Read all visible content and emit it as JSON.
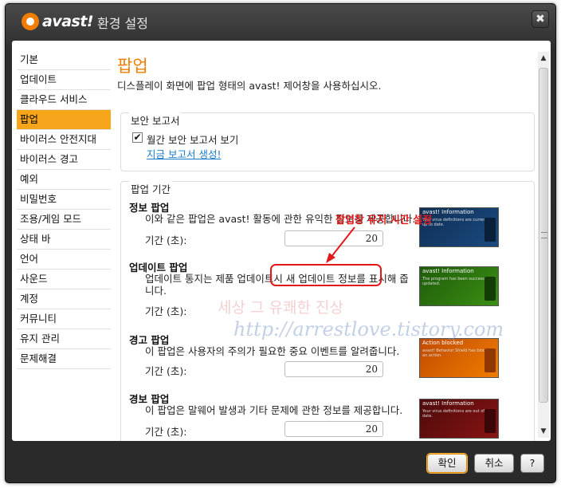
{
  "window": {
    "logo_text": "avast!",
    "title": "환경 설정",
    "close_glyph": "✖"
  },
  "sidebar": {
    "items": [
      {
        "label": "기본"
      },
      {
        "label": "업데이트"
      },
      {
        "label": "클라우드 서비스"
      },
      {
        "label": "팝업",
        "active": true
      },
      {
        "label": "바이러스 안전지대"
      },
      {
        "label": "바이러스 경고"
      },
      {
        "label": "예외"
      },
      {
        "label": "비밀번호"
      },
      {
        "label": "조용/게임 모드"
      },
      {
        "label": "상태 바"
      },
      {
        "label": "언어"
      },
      {
        "label": "사운드"
      },
      {
        "label": "계정"
      },
      {
        "label": "커뮤니티"
      },
      {
        "label": "유지 관리"
      },
      {
        "label": "문제해결"
      }
    ]
  },
  "main": {
    "title": "팝업",
    "description": "디스플레이 화면에 팝업 형태의 avast! 제어창을 사용하십시오.",
    "security_report": {
      "group_title": "보안 보고서",
      "checkbox_label": "월간 보안 보고서 보기",
      "checked": true,
      "link": "지금 보고서 생성!"
    },
    "popup_duration": {
      "group_title": "팝업 기간",
      "duration_label": "기간 (초):",
      "sections": [
        {
          "title": "정보 팝업",
          "description": "이와 같은 팝업은 avast! 활동에 관한 유익한 정보를 제공합니다.",
          "value": "20",
          "thumb_title": "avast! Information",
          "thumb_text": "Your virus definitions are currently up to date."
        },
        {
          "title": "업데이트 팝업",
          "description": "업데이트 통지는 제품 업데이트시 새 업데이트 정보를 표시해 줍니다.",
          "value": "20",
          "thumb_title": "avast! Information",
          "thumb_text": "The program has been successfully updated."
        },
        {
          "title": "경고 팝업",
          "description": "이 팝업은 사용자의 주의가 필요한 중요 이벤트를 알려줍니다.",
          "value": "20",
          "thumb_title": "Action blocked",
          "thumb_text": "avast! Behavior Shield has blocked an action."
        },
        {
          "title": "경보 팝업",
          "description": "이 팝업은 말웨어 발생과 기타 문제에 관한 정보를 제공합니다.",
          "value": "20",
          "thumb_title": "avast! Information",
          "thumb_text": "Your virus definitions are out of date."
        }
      ]
    },
    "annotation": "팝업창 유지 시간 설정",
    "watermark_line1": "세상 그 유쾌한 진상",
    "watermark_line2": "http://arrestlove.tistory.com"
  },
  "footer": {
    "ok_label": "확인",
    "cancel_label": "취소",
    "help_label": "?"
  },
  "colors": {
    "accent": "#f07d00",
    "active_nav": "#f7a51a",
    "link": "#1a7cc8",
    "annotation": "#e31818"
  }
}
